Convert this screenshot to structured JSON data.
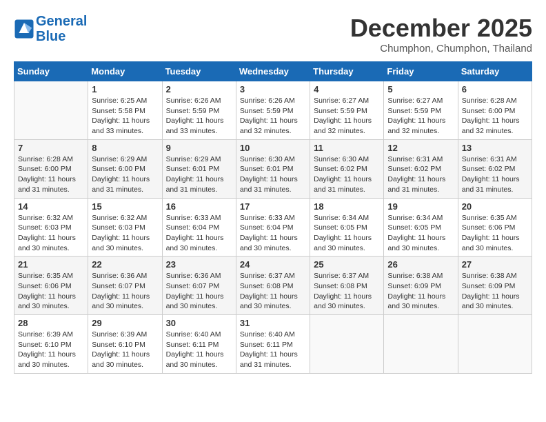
{
  "header": {
    "logo_line1": "General",
    "logo_line2": "Blue",
    "month": "December 2025",
    "location": "Chumphon, Chumphon, Thailand"
  },
  "weekdays": [
    "Sunday",
    "Monday",
    "Tuesday",
    "Wednesday",
    "Thursday",
    "Friday",
    "Saturday"
  ],
  "weeks": [
    [
      {
        "day": "",
        "info": ""
      },
      {
        "day": "1",
        "info": "Sunrise: 6:25 AM\nSunset: 5:58 PM\nDaylight: 11 hours\nand 33 minutes."
      },
      {
        "day": "2",
        "info": "Sunrise: 6:26 AM\nSunset: 5:59 PM\nDaylight: 11 hours\nand 33 minutes."
      },
      {
        "day": "3",
        "info": "Sunrise: 6:26 AM\nSunset: 5:59 PM\nDaylight: 11 hours\nand 32 minutes."
      },
      {
        "day": "4",
        "info": "Sunrise: 6:27 AM\nSunset: 5:59 PM\nDaylight: 11 hours\nand 32 minutes."
      },
      {
        "day": "5",
        "info": "Sunrise: 6:27 AM\nSunset: 5:59 PM\nDaylight: 11 hours\nand 32 minutes."
      },
      {
        "day": "6",
        "info": "Sunrise: 6:28 AM\nSunset: 6:00 PM\nDaylight: 11 hours\nand 32 minutes."
      }
    ],
    [
      {
        "day": "7",
        "info": "Sunrise: 6:28 AM\nSunset: 6:00 PM\nDaylight: 11 hours\nand 31 minutes."
      },
      {
        "day": "8",
        "info": "Sunrise: 6:29 AM\nSunset: 6:00 PM\nDaylight: 11 hours\nand 31 minutes."
      },
      {
        "day": "9",
        "info": "Sunrise: 6:29 AM\nSunset: 6:01 PM\nDaylight: 11 hours\nand 31 minutes."
      },
      {
        "day": "10",
        "info": "Sunrise: 6:30 AM\nSunset: 6:01 PM\nDaylight: 11 hours\nand 31 minutes."
      },
      {
        "day": "11",
        "info": "Sunrise: 6:30 AM\nSunset: 6:02 PM\nDaylight: 11 hours\nand 31 minutes."
      },
      {
        "day": "12",
        "info": "Sunrise: 6:31 AM\nSunset: 6:02 PM\nDaylight: 11 hours\nand 31 minutes."
      },
      {
        "day": "13",
        "info": "Sunrise: 6:31 AM\nSunset: 6:02 PM\nDaylight: 11 hours\nand 31 minutes."
      }
    ],
    [
      {
        "day": "14",
        "info": "Sunrise: 6:32 AM\nSunset: 6:03 PM\nDaylight: 11 hours\nand 30 minutes."
      },
      {
        "day": "15",
        "info": "Sunrise: 6:32 AM\nSunset: 6:03 PM\nDaylight: 11 hours\nand 30 minutes."
      },
      {
        "day": "16",
        "info": "Sunrise: 6:33 AM\nSunset: 6:04 PM\nDaylight: 11 hours\nand 30 minutes."
      },
      {
        "day": "17",
        "info": "Sunrise: 6:33 AM\nSunset: 6:04 PM\nDaylight: 11 hours\nand 30 minutes."
      },
      {
        "day": "18",
        "info": "Sunrise: 6:34 AM\nSunset: 6:05 PM\nDaylight: 11 hours\nand 30 minutes."
      },
      {
        "day": "19",
        "info": "Sunrise: 6:34 AM\nSunset: 6:05 PM\nDaylight: 11 hours\nand 30 minutes."
      },
      {
        "day": "20",
        "info": "Sunrise: 6:35 AM\nSunset: 6:06 PM\nDaylight: 11 hours\nand 30 minutes."
      }
    ],
    [
      {
        "day": "21",
        "info": "Sunrise: 6:35 AM\nSunset: 6:06 PM\nDaylight: 11 hours\nand 30 minutes."
      },
      {
        "day": "22",
        "info": "Sunrise: 6:36 AM\nSunset: 6:07 PM\nDaylight: 11 hours\nand 30 minutes."
      },
      {
        "day": "23",
        "info": "Sunrise: 6:36 AM\nSunset: 6:07 PM\nDaylight: 11 hours\nand 30 minutes."
      },
      {
        "day": "24",
        "info": "Sunrise: 6:37 AM\nSunset: 6:08 PM\nDaylight: 11 hours\nand 30 minutes."
      },
      {
        "day": "25",
        "info": "Sunrise: 6:37 AM\nSunset: 6:08 PM\nDaylight: 11 hours\nand 30 minutes."
      },
      {
        "day": "26",
        "info": "Sunrise: 6:38 AM\nSunset: 6:09 PM\nDaylight: 11 hours\nand 30 minutes."
      },
      {
        "day": "27",
        "info": "Sunrise: 6:38 AM\nSunset: 6:09 PM\nDaylight: 11 hours\nand 30 minutes."
      }
    ],
    [
      {
        "day": "28",
        "info": "Sunrise: 6:39 AM\nSunset: 6:10 PM\nDaylight: 11 hours\nand 30 minutes."
      },
      {
        "day": "29",
        "info": "Sunrise: 6:39 AM\nSunset: 6:10 PM\nDaylight: 11 hours\nand 30 minutes."
      },
      {
        "day": "30",
        "info": "Sunrise: 6:40 AM\nSunset: 6:11 PM\nDaylight: 11 hours\nand 30 minutes."
      },
      {
        "day": "31",
        "info": "Sunrise: 6:40 AM\nSunset: 6:11 PM\nDaylight: 11 hours\nand 31 minutes."
      },
      {
        "day": "",
        "info": ""
      },
      {
        "day": "",
        "info": ""
      },
      {
        "day": "",
        "info": ""
      }
    ]
  ]
}
